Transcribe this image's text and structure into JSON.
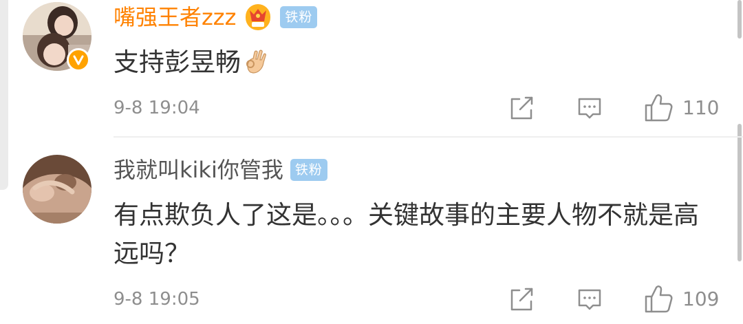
{
  "comments": [
    {
      "username": "嘴强王者zzz",
      "badge": "铁粉",
      "text": "支持彭昱畅",
      "emoji": "ok-hand-icon",
      "timestamp": "9-8 19:04",
      "like_count": "110",
      "verified": true,
      "vip": true
    },
    {
      "username": "我就叫kiki你管我",
      "badge": "铁粉",
      "text": "有点欺负人了这是。。。关键故事的主要人物不就是高远吗？",
      "timestamp": "9-8 19:05",
      "like_count": "109",
      "verified": false,
      "vip": false
    }
  ],
  "colors": {
    "vip_name": "#ff8200",
    "normal_name": "#555555",
    "badge_bg": "#9dcbf0",
    "meta_text": "#8e8e8e",
    "body_text": "#333333",
    "verified_badge": "#ffa200"
  },
  "icons": [
    "crown-icon",
    "share-icon",
    "reply-icon",
    "like-icon",
    "verified-badge-icon"
  ]
}
